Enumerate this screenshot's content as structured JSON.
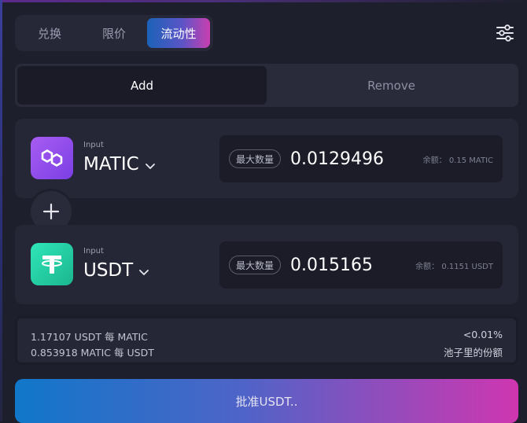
{
  "tabs": {
    "swap": "兑换",
    "limit": "限价",
    "liquidity": "流动性"
  },
  "mode": {
    "add": "Add",
    "remove": "Remove"
  },
  "token_a": {
    "input_label": "Input",
    "symbol": "MATIC",
    "icon": "polygon-matic-icon",
    "max_label": "最大数量",
    "amount": "0.0129496",
    "balance": "余额：  0.15 MATIC"
  },
  "token_b": {
    "input_label": "Input",
    "symbol": "USDT",
    "icon": "tether-usdt-icon",
    "max_label": "最大数量",
    "amount": "0.015165",
    "balance": "余额：  0.1151 USDT"
  },
  "prices": {
    "usdt_per_matic": "1.17107 USDT 每 MATIC",
    "matic_per_usdt": "0.853918 MATIC 每 USDT",
    "pool_share_value": "<0.01%",
    "pool_share_label": "池子里的份额"
  },
  "approve_button": "批准USDT..",
  "colors": {
    "accent_start": "#1b62b8",
    "accent_end": "#c93fb0",
    "background": "#1e1f2c",
    "card": "#262736"
  }
}
